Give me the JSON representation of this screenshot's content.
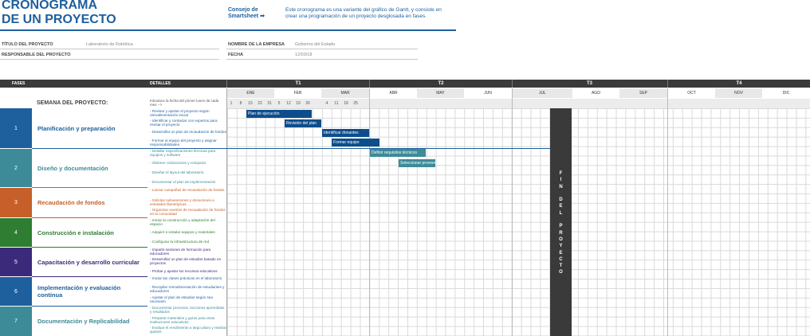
{
  "header": {
    "title_line1": "CRONOGRAMA",
    "title_line2": "DE UN PROYECTO",
    "tip_title_line1": "Consejo de",
    "tip_title_line2": "Smartsheet ➡",
    "tip_text": "Este cronograma es una variante del gráfico de Gantt, y consiste en crear una programación de un proyecto desglosada en fases."
  },
  "meta": {
    "title_label": "TÍTULO DEL PROYECTO",
    "title_value": "Laboratorio de Robótica",
    "manager_label": "RESPONSABLE DEL PROYECTO",
    "manager_value": "",
    "company_label": "NOMBRE DE LA EMPRESA",
    "company_value": "Gobierno del Estado",
    "date_label": "FECHA",
    "date_value": "12/03/18"
  },
  "table": {
    "col_phases": "FASES",
    "col_details": "DETALLES",
    "week_label": "SEMANA DEL PROYECTO:",
    "intro_text": "Introduce la fecha del primer lunes de cada mes -->",
    "quarters": [
      "T1",
      "T2",
      "T3",
      "T4"
    ],
    "months": [
      "ENE",
      "FEB",
      "MAR",
      "ABR",
      "MAY",
      "JUN",
      "JUL",
      "AGO",
      "SEP",
      "OCT",
      "NOV",
      "DIC"
    ],
    "weeks": [
      "1",
      "8",
      "15",
      "22",
      "31",
      "5",
      "12",
      "19",
      "26",
      "4",
      "11",
      "18",
      "25"
    ],
    "end_label": "FIN DEL PROYECTO"
  },
  "phases": [
    {
      "num": "1",
      "name": "Planificación y preparación",
      "color": "#1e5f9e",
      "tasks": [
        "- Revisar y ajustar el proyecto según retroalimentación inicial",
        "- Identificar y contactar con expertos para revisar el proyecto",
        "- Desarrollar un plan de recaudación de fondos",
        "- Formar al equipo del proyecto y asignar responsabilidades"
      ]
    },
    {
      "num": "2",
      "name": "Diseño y documentación",
      "color": "#3d8a98",
      "tasks": [
        "- Detallar especificaciones técnicas para equipos y software",
        "- Obtener cotizaciones y comparar",
        "- Diseñar el layout del laboratorio",
        "- Documentar el plan de implementación"
      ]
    },
    {
      "num": "3",
      "name": "Recaudación de fondos",
      "color": "#c75f2a",
      "tasks": [
        "- Lanzar campañas de recaudación de fondos",
        "- Solicitar subvenciones y donaciones a entidades filantrópicas",
        "- Organizar eventos de recaudación de fondos en la comunidad"
      ]
    },
    {
      "num": "4",
      "name": "Construcción e instalación",
      "color": "#2e7d32",
      "tasks": [
        "- Iniciar la construcción y adaptación del espacio",
        "- Adquirir e instalar equipos y materiales",
        "- Configurar la infraestructura de red"
      ]
    },
    {
      "num": "5",
      "name": "Capacitación y desarrollo curricular",
      "color": "#3b2a7a",
      "tasks": [
        "- Impartir sesiones de formación para educadores",
        "- Desarrollar un plan de estudios basado en proyectos",
        "- Probar y ajustar los recursos educativos"
      ]
    },
    {
      "num": "6",
      "name": "Implementación y evaluación continua",
      "color": "#1e5f9e",
      "tasks": [
        "- Iniciar las clases prácticas en el laboratorio",
        "- Recopilar retroalimentación de estudiantes y educadores",
        "- Ajustar el plan de estudios según sea necesario"
      ]
    },
    {
      "num": "7",
      "name": "Documentación y Replicabilidad",
      "color": "#3d8a98",
      "tasks": [
        "- Documentar procesos, lecciones aprendidas y resultados",
        "- Preparar materiales y guías para otras instituciones educativas",
        "- Evaluar el rendimiento a largo plazo y realizar ajustes"
      ]
    }
  ],
  "bars": [
    {
      "label": "Plan de ejecución",
      "color": "#0d4d8c"
    },
    {
      "label": "Revisión del plan",
      "color": "#0d4d8c"
    },
    {
      "label": "Identificar donantes",
      "color": "#0d4d8c"
    },
    {
      "label": "Formar equipo",
      "color": "#0d4d8c"
    },
    {
      "label": "Definir requisitos técnicos",
      "color": "#3d8a98"
    },
    {
      "label": "Seleccionar proveedores",
      "color": "#3d8a98"
    }
  ]
}
